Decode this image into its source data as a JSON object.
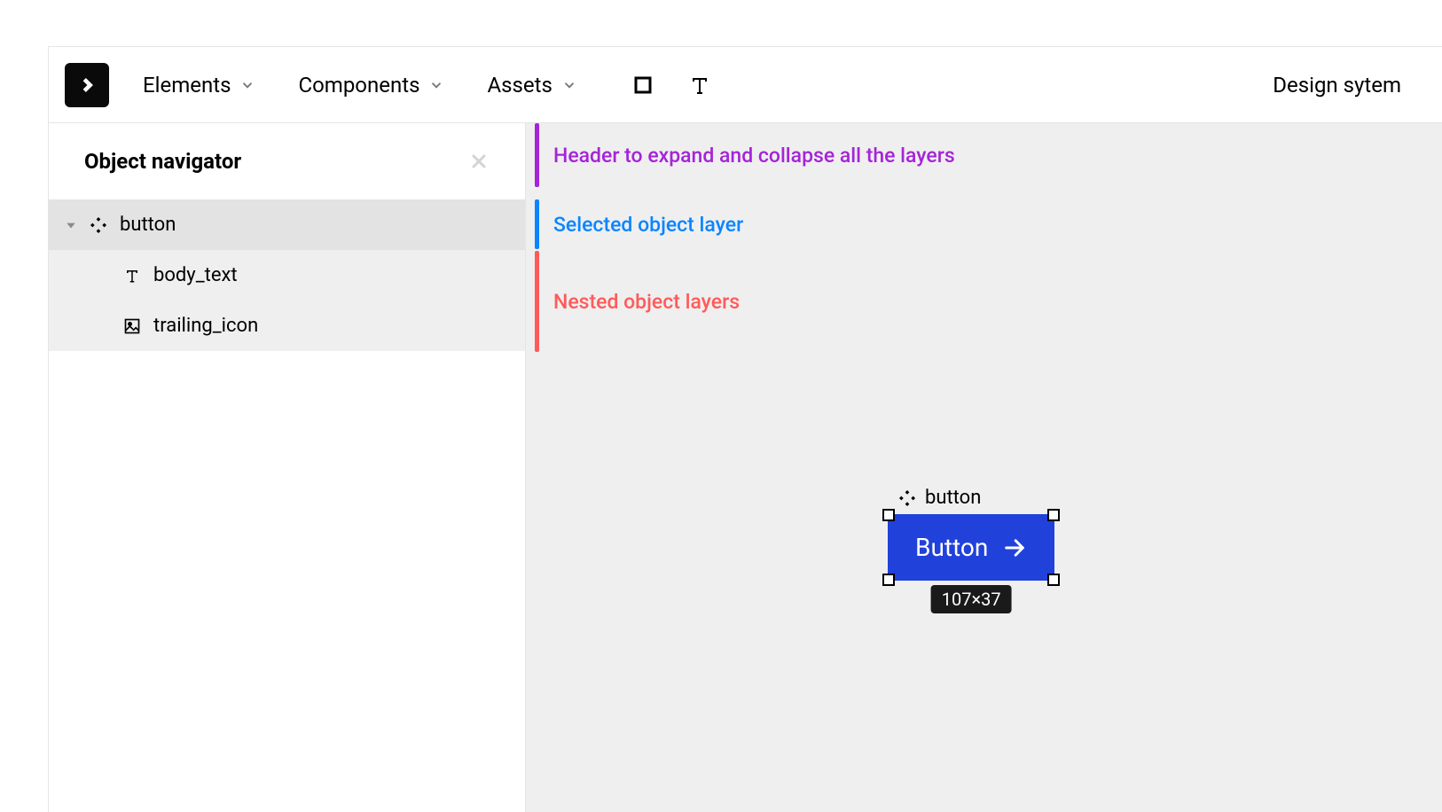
{
  "toolbar": {
    "menu": [
      {
        "label": "Elements"
      },
      {
        "label": "Components"
      },
      {
        "label": "Assets"
      }
    ],
    "file_name": "Design sytem"
  },
  "sidebar": {
    "title": "Object navigator",
    "layers": {
      "root": {
        "name": "button",
        "type": "component"
      },
      "children": [
        {
          "name": "body_text",
          "type": "text"
        },
        {
          "name": "trailing_icon",
          "type": "image"
        }
      ]
    }
  },
  "annotations": {
    "purple": "Header to expand and collapse all the layers",
    "blue": "Selected object layer",
    "red": "Nested object layers"
  },
  "canvas_object": {
    "label": "button",
    "button_text": "Button",
    "size_badge": "107×37"
  }
}
